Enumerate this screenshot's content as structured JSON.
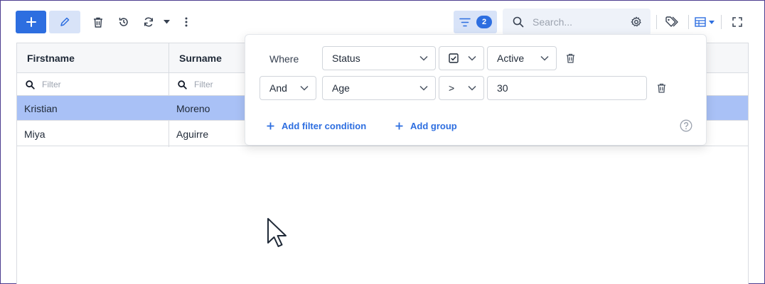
{
  "toolbar": {
    "filter_count": "2",
    "search_placeholder": "Search...",
    "add_icon": "plus-icon",
    "edit_icon": "pencil-icon",
    "delete_icon": "trash-icon",
    "undo_icon": "history-icon",
    "refresh_icon": "refresh-icon",
    "more_icon": "more-vertical-icon",
    "tag_icon": "tag-icon",
    "columns_icon": "table-columns-icon",
    "fullscreen_icon": "fullscreen-icon"
  },
  "table": {
    "columns": [
      {
        "label": "Firstname"
      },
      {
        "label": "Surname"
      }
    ],
    "filter_placeholder": "Filter",
    "rows": [
      {
        "firstname": "Kristian",
        "surname": "Moreno",
        "selected": true
      },
      {
        "firstname": "Miya",
        "surname": "Aguirre",
        "selected": false
      }
    ]
  },
  "filter_panel": {
    "conditions": [
      {
        "connector": "Where",
        "field": "Status",
        "operator": "checkbox",
        "value": "Active"
      },
      {
        "connector": "And",
        "field": "Age",
        "operator": ">",
        "value": "30"
      }
    ],
    "add_condition_label": "Add filter condition",
    "add_group_label": "Add group"
  },
  "colors": {
    "primary": "#2d6ee0",
    "primary_light": "#d8e3f8",
    "selected_row": "#a9c1f6",
    "border": "#d9dce1"
  }
}
